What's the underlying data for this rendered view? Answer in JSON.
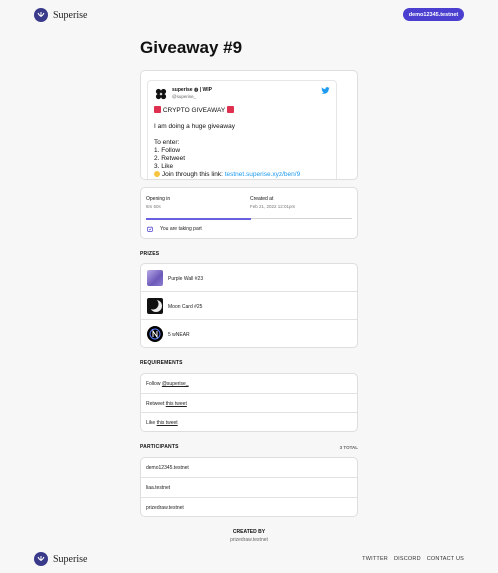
{
  "header": {
    "brand": "Superise",
    "account_label": "demo12345.testnet"
  },
  "page": {
    "title": "Giveaway #9"
  },
  "tweet": {
    "author": "superise ◍ | WIP",
    "handle": "@superise_",
    "line1": "CRYPTO GIVEAWAY",
    "line2": "I am doing a huge giveaway",
    "line3": "To enter:",
    "line4": "1. Follow",
    "line5": "2. Retweet",
    "line6": "3. Like",
    "line7_prefix": "Join through this link:",
    "line7_link": "testnet.superise.xyz/ben/9"
  },
  "status": {
    "opening_label": "Opening in",
    "opening_value": "8m 50s",
    "created_label": "Created at",
    "created_value": "Feb 21, 2022 12:01pm",
    "progress_fraction": 0.51,
    "taking_part": "You are taking part"
  },
  "prizes": {
    "title": "PRIZES",
    "items": [
      {
        "name": "Purple Wall #23"
      },
      {
        "name": "Moon Card #25"
      },
      {
        "name": "5 wNEAR"
      }
    ]
  },
  "requirements": {
    "title": "REQUIREMENTS",
    "items": [
      {
        "text": "Follow",
        "link": "@superise_"
      },
      {
        "text": "Retweet",
        "link": "this tweet"
      },
      {
        "text": "Like",
        "link": "this tweet"
      }
    ]
  },
  "participants": {
    "title": "PARTICIPANTS",
    "total": "3 TOTAL",
    "items": [
      {
        "name": "demo12345.testnet"
      },
      {
        "name": "liaa.testnet"
      },
      {
        "name": "prizedraw.testnet"
      }
    ]
  },
  "created": {
    "label": "CREATED BY",
    "name": "prizedraw.testnet"
  },
  "footer": {
    "brand": "Superise",
    "links": [
      "TWITTER",
      "DISCORD",
      "CONTACT US"
    ]
  },
  "colors": {
    "accent": "#4b3fcf",
    "progress": "#6a5fe0",
    "twitter": "#1d9bf0"
  }
}
